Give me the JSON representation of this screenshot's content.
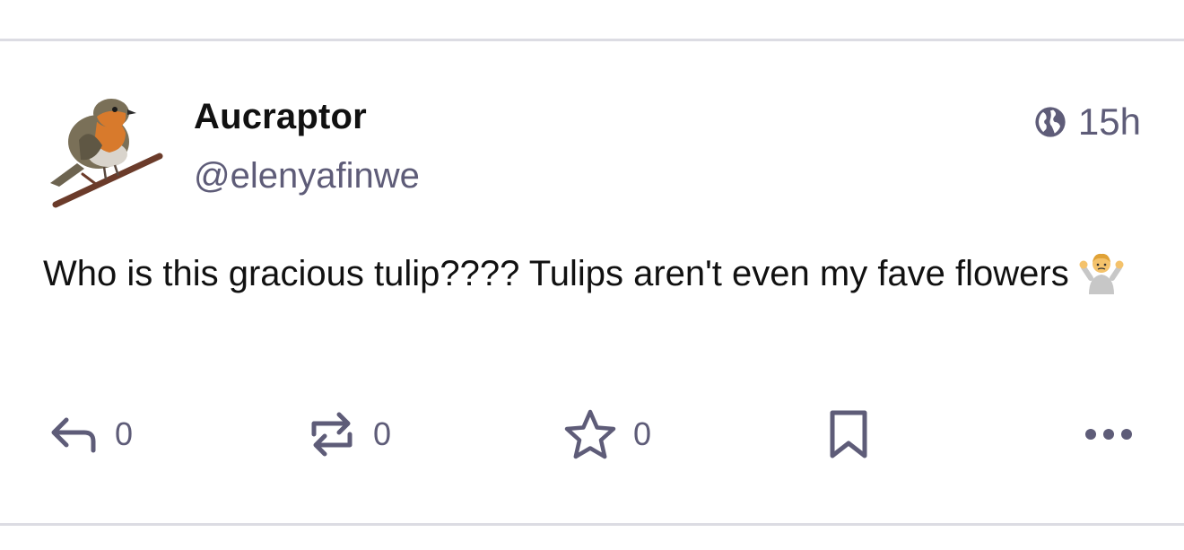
{
  "post": {
    "display_name": "Aucraptor",
    "handle": "@elenyafinwe",
    "visibility_icon": "globe-icon",
    "time": "15h",
    "text": "Who is this gracious tulip???? Tulips aren't even my fave flowers",
    "emoji": "person-shrugging"
  },
  "actions": {
    "reply_count": "0",
    "boost_count": "0",
    "favourite_count": "0"
  },
  "colors": {
    "icon": "#5e5c78",
    "divider": "#dcdce3",
    "text": "#111111"
  }
}
